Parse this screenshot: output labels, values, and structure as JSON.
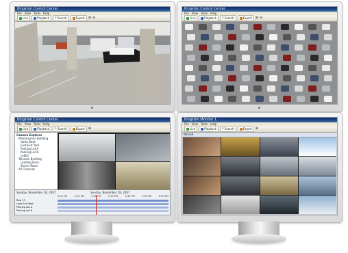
{
  "windows": [
    {
      "id": "tl",
      "title": "Kingston Control Center",
      "menus": [
        "File",
        "View",
        "Tools",
        "Help"
      ],
      "toolbar": [
        "Live",
        "Playback",
        "Search",
        "Export"
      ]
    },
    {
      "id": "tr",
      "title": "Kingston Control Center",
      "menus": [
        "File",
        "View",
        "Tools",
        "Help"
      ],
      "toolbar": [
        "Live",
        "Playback",
        "Search",
        "Export"
      ]
    },
    {
      "id": "bl",
      "title": "Kingston Control Center",
      "menus": [
        "File",
        "View",
        "Tools",
        "Help"
      ],
      "toolbar": [
        "Live",
        "Playback",
        "Search",
        "Export"
      ],
      "tree": [
        "Camera Explorer",
        "Maintenance Building",
        "Hotel Desk",
        "East Exit Yard",
        "Parking Lot A",
        "Parking Lot B",
        "Lobby",
        "Telecom Building",
        "Loading Dock",
        "Server Room",
        "All Cameras"
      ],
      "timeline_date": "Sunday, November 18, 2007",
      "timeline_label": "Sunday, November 18, 2007",
      "timeline_rows": [
        "Row 13",
        "Look Exit Yard",
        "Parking Lot A",
        "Parking Lot B"
      ],
      "timeline_times": [
        "5:00 PM",
        "5:10 PM",
        "5:20 PM",
        "5:30 PM",
        "5:40 PM",
        "5:50 PM",
        "6:00 PM"
      ]
    },
    {
      "id": "br",
      "title": "Kingston Monitor 1",
      "menus": [
        "File",
        "View",
        "Tools",
        "Help"
      ],
      "toolbar": [
        "Live",
        "Playback",
        "Search",
        "Export"
      ],
      "view_label": "Named"
    }
  ],
  "colors": {
    "accent": "#0a246a",
    "live": "#2f9b3a",
    "playback": "#2a62c9",
    "search": "#6a6a6a"
  }
}
